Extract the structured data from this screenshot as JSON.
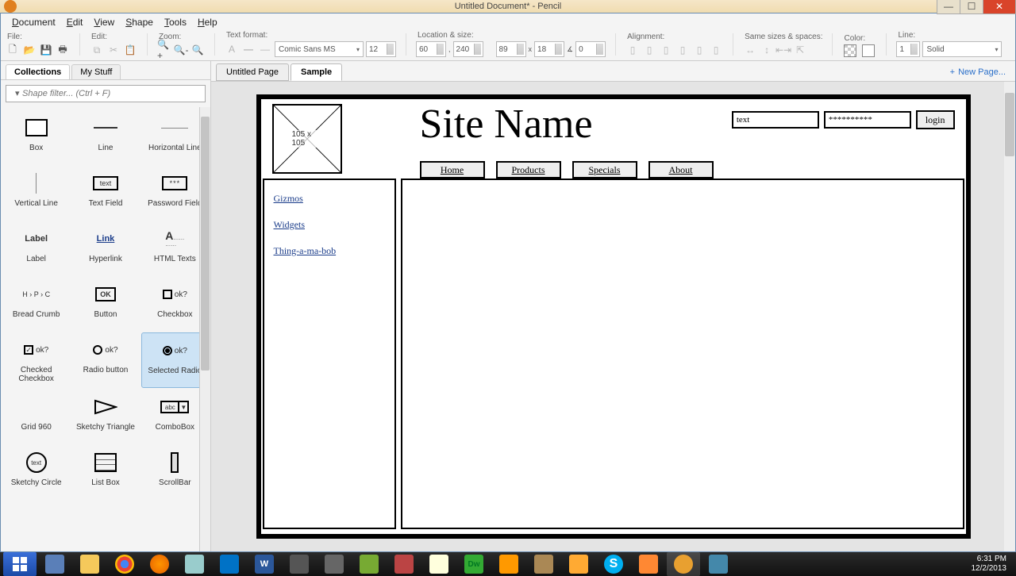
{
  "window": {
    "title": "Untitled Document* - Pencil"
  },
  "menu": {
    "items": [
      "Document",
      "Edit",
      "View",
      "Shape",
      "Tools",
      "Help"
    ]
  },
  "toolbar": {
    "file_label": "File:",
    "edit_label": "Edit:",
    "zoom_label": "Zoom:",
    "text_format_label": "Text format:",
    "font": "Comic Sans MS",
    "font_size": "12",
    "loc_size_label": "Location & size:",
    "x": "60",
    "y": "240",
    "w": "89",
    "h": "18",
    "a": "0",
    "align_label": "Alignment:",
    "same_label": "Same sizes & spaces:",
    "color_label": "Color:",
    "line_label": "Line:",
    "line_w": "1",
    "line_style": "Solid"
  },
  "sidebar": {
    "tabs": [
      "Collections",
      "My Stuff"
    ],
    "active_tab": 0,
    "filter_placeholder": "Shape filter... (Ctrl + F)",
    "shapes": [
      {
        "label": "Box"
      },
      {
        "label": "Line"
      },
      {
        "label": "Horizontal Line"
      },
      {
        "label": "Vertical Line"
      },
      {
        "label": "Text Field"
      },
      {
        "label": "Password Field"
      },
      {
        "label": "Label"
      },
      {
        "label": "Hyperlink"
      },
      {
        "label": "HTML Texts"
      },
      {
        "label": "Bread Crumb"
      },
      {
        "label": "Button"
      },
      {
        "label": "Checkbox"
      },
      {
        "label": "Checked Checkbox"
      },
      {
        "label": "Radio button"
      },
      {
        "label": "Selected Radio"
      },
      {
        "label": "Grid 960"
      },
      {
        "label": "Sketchy Triangle"
      },
      {
        "label": "ComboBox"
      },
      {
        "label": "Sketchy Circle"
      },
      {
        "label": "List Box"
      },
      {
        "label": "ScrollBar"
      }
    ],
    "selected_shape": 14,
    "prev": {
      "text": "text",
      "pwd": "***",
      "label": "Label",
      "link": "Link",
      "bread": "H › P › C",
      "btn": "OK",
      "ok": "ok?",
      "combo": "abc",
      "circle": "text",
      "html": "A"
    }
  },
  "pages": {
    "tabs": [
      "Untitled Page",
      "Sample"
    ],
    "active": 1,
    "new_page": "New Page..."
  },
  "mockup": {
    "img_label": "105 x 105",
    "title": "Site Name",
    "login": {
      "text": "text",
      "pwd": "**********",
      "btn": "login"
    },
    "nav": [
      "Home",
      "Products",
      "Specials",
      "About"
    ],
    "side_links": [
      "Gizmos",
      "Widgets",
      "Thing-a-ma-bob"
    ]
  },
  "system": {
    "time": "6:31 PM",
    "date": "12/2/2013"
  }
}
